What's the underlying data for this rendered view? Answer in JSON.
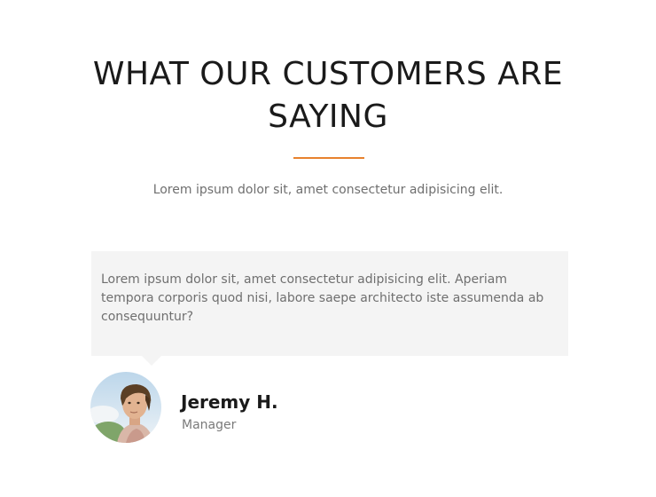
{
  "section": {
    "title": "WHAT OUR CUSTOMERS ARE SAYING",
    "subtitle": "Lorem ipsum dolor sit, amet consectetur adipisicing elit.",
    "accent_color": "#e8822e"
  },
  "testimonial": {
    "text": "Lorem ipsum dolor sit, amet consectetur adipisicing elit. Aperiam tempora corporis quod nisi, labore saepe architecto iste assumenda ab consequuntur?",
    "card_color": "#f4f4f4",
    "author": {
      "name": "Jeremy H.",
      "role": "Manager",
      "avatar_icon": "avatar-photo-icon"
    }
  }
}
